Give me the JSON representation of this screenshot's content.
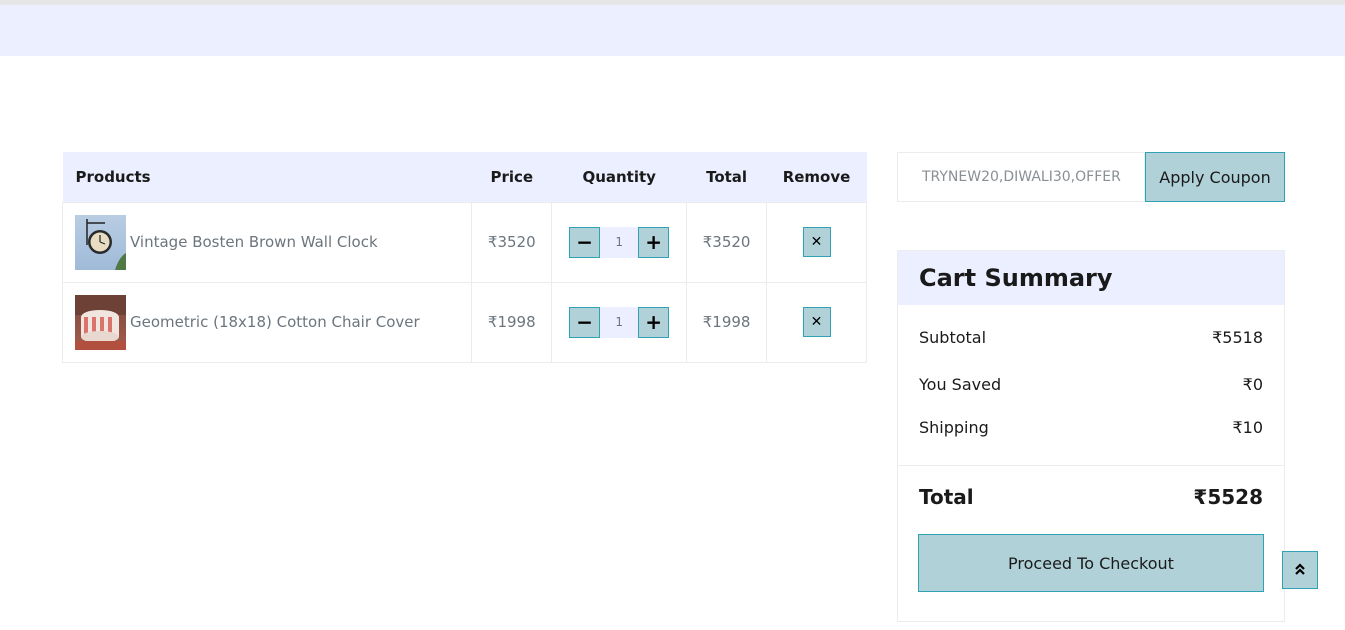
{
  "table": {
    "headers": {
      "products": "Products",
      "price": "Price",
      "quantity": "Quantity",
      "total": "Total",
      "remove": "Remove"
    },
    "rows": [
      {
        "name": "Vintage Bosten Brown Wall Clock",
        "price": "₹3520",
        "qty": "1",
        "total": "₹3520"
      },
      {
        "name": "Geometric (18x18) Cotton Chair Cover",
        "price": "₹1998",
        "qty": "1",
        "total": "₹1998"
      }
    ],
    "minus_symbol": "−",
    "plus_symbol": "+",
    "remove_symbol": "✕"
  },
  "coupon": {
    "placeholder": "TRYNEW20,DIWALI30,OFFER",
    "button_label": "Apply Coupon"
  },
  "summary": {
    "title": "Cart Summary",
    "subtotal_label": "Subtotal",
    "subtotal_value": "₹5518",
    "saved_label": "You Saved",
    "saved_value": "₹0",
    "shipping_label": "Shipping",
    "shipping_value": "₹10",
    "total_label": "Total",
    "total_value": "₹5528",
    "checkout_label": "Proceed To Checkout"
  },
  "icons": {
    "scroll_top": "double-chevron-up-icon",
    "product_1": "wall-clock-thumbnail",
    "product_2": "chair-cover-thumbnail"
  },
  "colors": {
    "header_bg": "#ebefff",
    "button_bg": "#b1d1d9",
    "button_border": "#2fa3b5"
  }
}
